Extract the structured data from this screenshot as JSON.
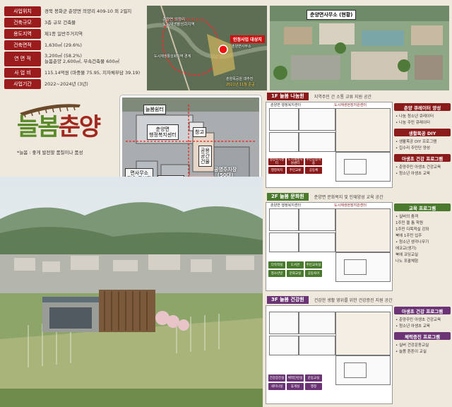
{
  "info": {
    "rows": [
      {
        "key": "사업위치",
        "value": "경북 봉화군 춘양면 의양리 409-10 외 2필지"
      },
      {
        "key": "건축규모",
        "value": "3층 규모 건축물"
      },
      {
        "key": "용도지역",
        "value": "제1종 일반주거지역"
      },
      {
        "key": "건축면적",
        "value": "1,630㎡ (29.6%)"
      },
      {
        "key": "연 면 적",
        "value": "3,200㎡ (58.2%)",
        "value2": "늘봄춘양 2,600㎡, 부속건축물 600㎡"
      },
      {
        "key": "사 업 비",
        "value": "115.14억원 (마중물 75.95, 지자체부담 39.19)"
      },
      {
        "key": "사업기간",
        "value": "2022~2024년 (3년)"
      }
    ]
  },
  "map": {
    "label_area": "춘양면 의양리\n도시재생활성화지역",
    "label_boundary": "도시재생활성화지역 경계",
    "label_target": "인정사업 대상지",
    "label_target_sub": "춘양면사무소",
    "label_park": "춘양목공원 대추진",
    "label_park_sub": "2021년 11월 준공"
  },
  "photo_top": {
    "label": "춘양면사무소 (현황)"
  },
  "logo": {
    "title": "늘봄춘양",
    "tagline": "*늘봄 : 좋게 발전할 품질이나 품성"
  },
  "sitemap": {
    "labels": [
      {
        "name": "neulbom-hall",
        "text": "늘봄쉼터"
      },
      {
        "name": "office",
        "text": "춘양면\n행정복지센터"
      },
      {
        "name": "warehouse",
        "text": "창고"
      },
      {
        "name": "plaza-building",
        "text": "공용\n공간\n건물"
      },
      {
        "name": "parking-a",
        "text": "면사무소\n전용 주차장\n(11대)"
      },
      {
        "name": "parking-b",
        "text": "공영주차장\n(24대)"
      },
      {
        "name": "parking-c",
        "text": "공영주차장\n(50대)"
      },
      {
        "name": "plaza",
        "text": "진입광장"
      }
    ]
  },
  "floors": [
    {
      "tag": "1F 늘봄 나눔원",
      "subtitle": "지역주민 간 소통 교류 지원 공간",
      "plan_titles": [
        "춘양면 행정복지센터",
        "도시재생현장지원센터"
      ],
      "program": [
        {
          "head": "춘양 큐레이터 양성",
          "items": [
            "• 나눔 청소년 큐레이터",
            "• 나눔 주민 큐레이터"
          ]
        },
        {
          "head": "생활목공 DIY",
          "items": [
            "• 생활목공 DIY 프로그램",
            "• 집수리 주민단 양성"
          ]
        },
        {
          "head": "아생초 건강 프로그램",
          "items": [
            "• 춘양주민 아생초 건강교육",
            "• 청소년 아생초 교육"
          ]
        }
      ],
      "mini_labels": [
        "행정복지센터",
        "도시재생지원센터",
        "주민공동이용",
        "행정복지",
        "주민교류",
        "공동체"
      ]
    },
    {
      "tag": "2F 늘봄 문화원",
      "subtitle": "춘양면 문화복지 및 인재양성 교육 공간",
      "plan_titles": [
        "춘양면 행정복지센터",
        "도시재생현장지원센터"
      ],
      "program": [
        {
          "head": "교육 프로그램",
          "items": [
            "• 실버의 춤객",
            "1주민 울 틈 학원",
            "1주민 다목적실 강좌",
            "북에 1주민 입주",
            "• 청소년 생각나무기",
            "에코교(생기)",
            "북에 코딩교실",
            "나노 포괄체험"
          ]
        }
      ],
      "mini_labels": [
        "다목적실",
        "도서관",
        "주민교육실",
        "청소년방",
        "문화교실",
        "공동육아"
      ]
    },
    {
      "tag": "3F 늘봄 건강원",
      "subtitle": "건강한 생활 영위를 위한 건강증진 지원 공간",
      "program": [
        {
          "head": "아생초 건강 프로그램",
          "items": [
            "• 춘양주민 아생초 건강교육",
            "• 청소년 아생초 교육"
          ]
        },
        {
          "head": "체력증진 프로그램",
          "items": [
            "• 실버 건강운동교실",
            "• 늘봄 튼튼이 교실"
          ]
        }
      ],
      "mini_labels": [
        "건강증진실",
        "체력단련실",
        "운동교실",
        "세미나실",
        "휴게실",
        "행정"
      ]
    }
  ],
  "colors": {
    "accent": "#8b1a1a",
    "green": "#4a7a2e",
    "purple": "#6b3575",
    "bg": "#efe9dd"
  }
}
